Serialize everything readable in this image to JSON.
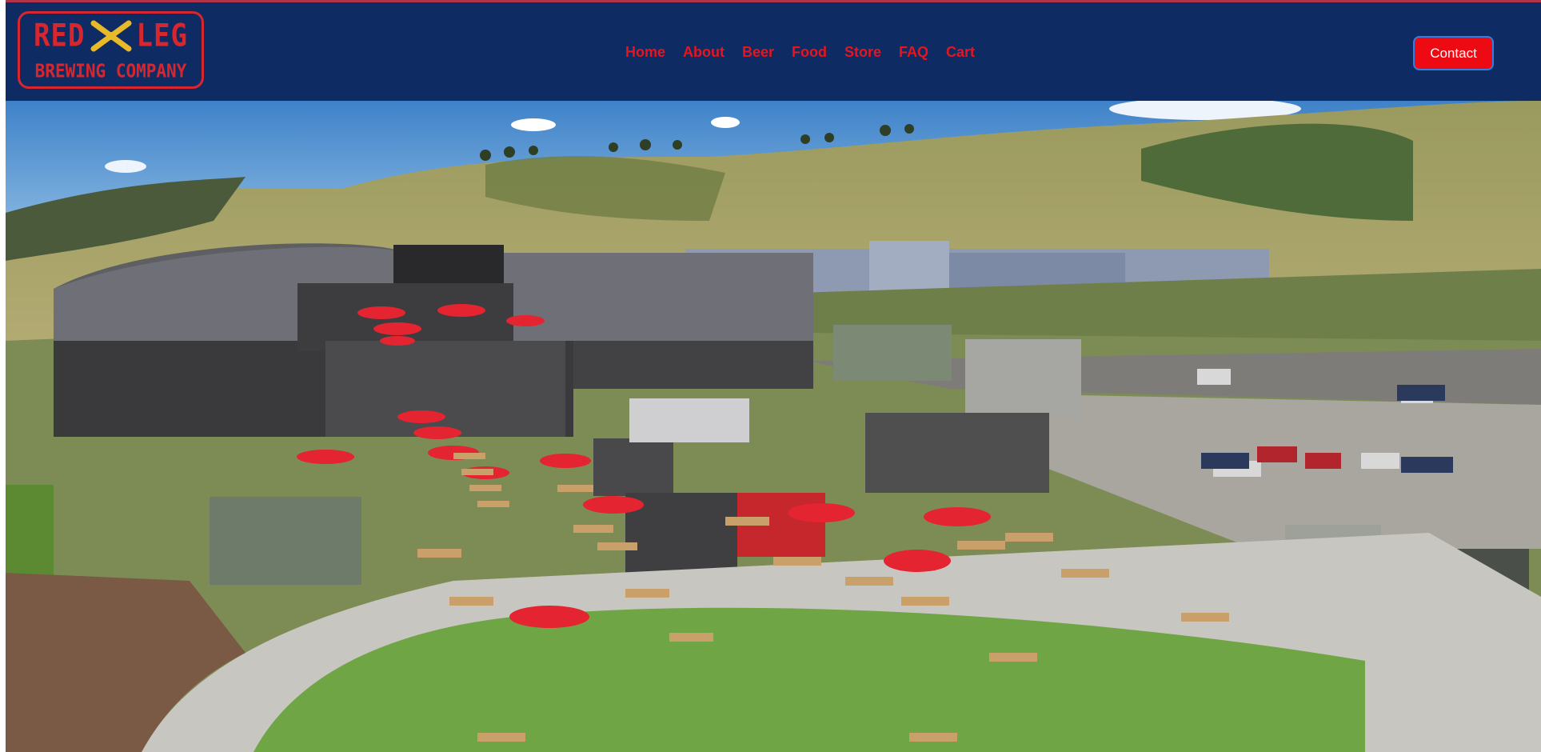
{
  "brand": {
    "logo_line1_left": "RED",
    "logo_line1_right": "LEG",
    "logo_line2": "BREWING COMPANY",
    "primary_color": "#0e2c63",
    "accent_color": "#d8262f"
  },
  "nav": {
    "items": [
      {
        "label": "Home"
      },
      {
        "label": "About"
      },
      {
        "label": "Beer"
      },
      {
        "label": "Food"
      },
      {
        "label": "Store"
      },
      {
        "label": "FAQ"
      },
      {
        "label": "Cart"
      }
    ],
    "link_color": "#e8141e"
  },
  "contact_button": {
    "label": "Contact",
    "background": "#ee0a12"
  },
  "hero": {
    "icon": "aerial-brewery-photo"
  }
}
